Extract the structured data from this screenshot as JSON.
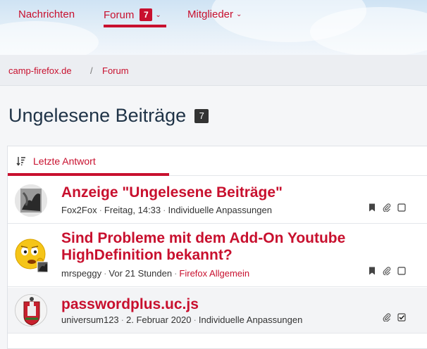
{
  "nav": {
    "items": [
      {
        "label": "Nachrichten"
      },
      {
        "label": "Forum",
        "badge": "7"
      },
      {
        "label": "Mitglieder"
      }
    ]
  },
  "breadcrumb": {
    "items": [
      "camp-firefox.de",
      "Forum"
    ],
    "separator": "/"
  },
  "page": {
    "title": "Ungelesene Beiträge",
    "count": "7"
  },
  "tabs": {
    "active_label": "Letzte Antwort",
    "icon": "sort-descending-icon"
  },
  "threads": [
    {
      "title": "Anzeige \"Ungelesene Beiträge\"",
      "author": "Fox2Fox",
      "time": "Freitag, 14:33",
      "forum": "Individuelle Anpassungen",
      "icons": [
        "bookmark-icon",
        "attachment-icon",
        "checkbox-icon"
      ]
    },
    {
      "title": "Sind Probleme mit dem Add-On Youtube HighDefinition bekannt?",
      "author": "mrspeggy",
      "time": "Vor 21 Stunden",
      "forum": "Firefox Allgemein",
      "icons": [
        "bookmark-icon",
        "attachment-icon",
        "checkbox-icon"
      ]
    },
    {
      "title": "passwordplus.uc.js",
      "author": "universum123",
      "time": "2. Februar 2020",
      "forum": "Individuelle Anpassungen",
      "icons": [
        "attachment-icon",
        "checkbox-checked-icon"
      ]
    }
  ],
  "colors": {
    "accent": "#c8102e",
    "title_text": "#1f3347",
    "badge_dark": "#333333"
  }
}
